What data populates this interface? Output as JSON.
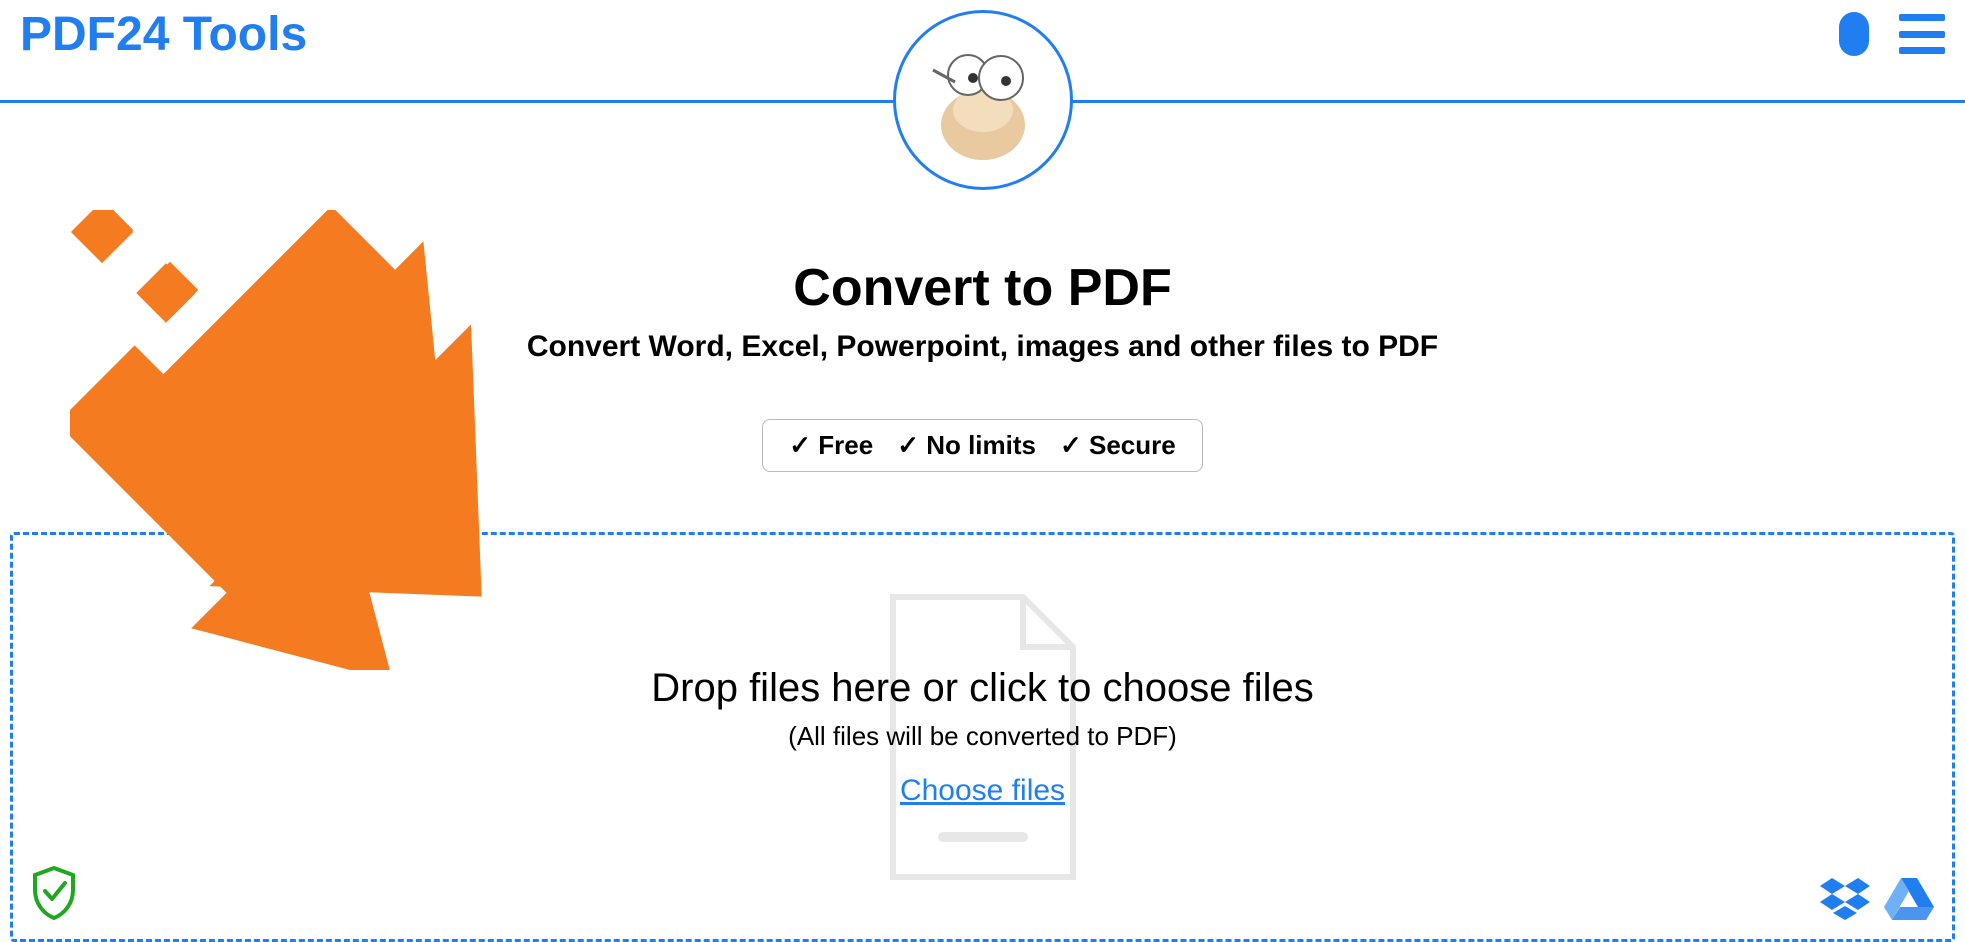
{
  "header": {
    "logo": "PDF24 Tools"
  },
  "main": {
    "title": "Convert to PDF",
    "subtitle": "Convert Word, Excel, Powerpoint, images and other files to PDF",
    "badges": {
      "free": "✓ Free",
      "nolimits": "✓ No limits",
      "secure": "✓ Secure"
    }
  },
  "dropzone": {
    "title": "Drop files here or click to choose files",
    "subtitle": "(All files will be converted to PDF)",
    "choose": "Choose files"
  }
}
